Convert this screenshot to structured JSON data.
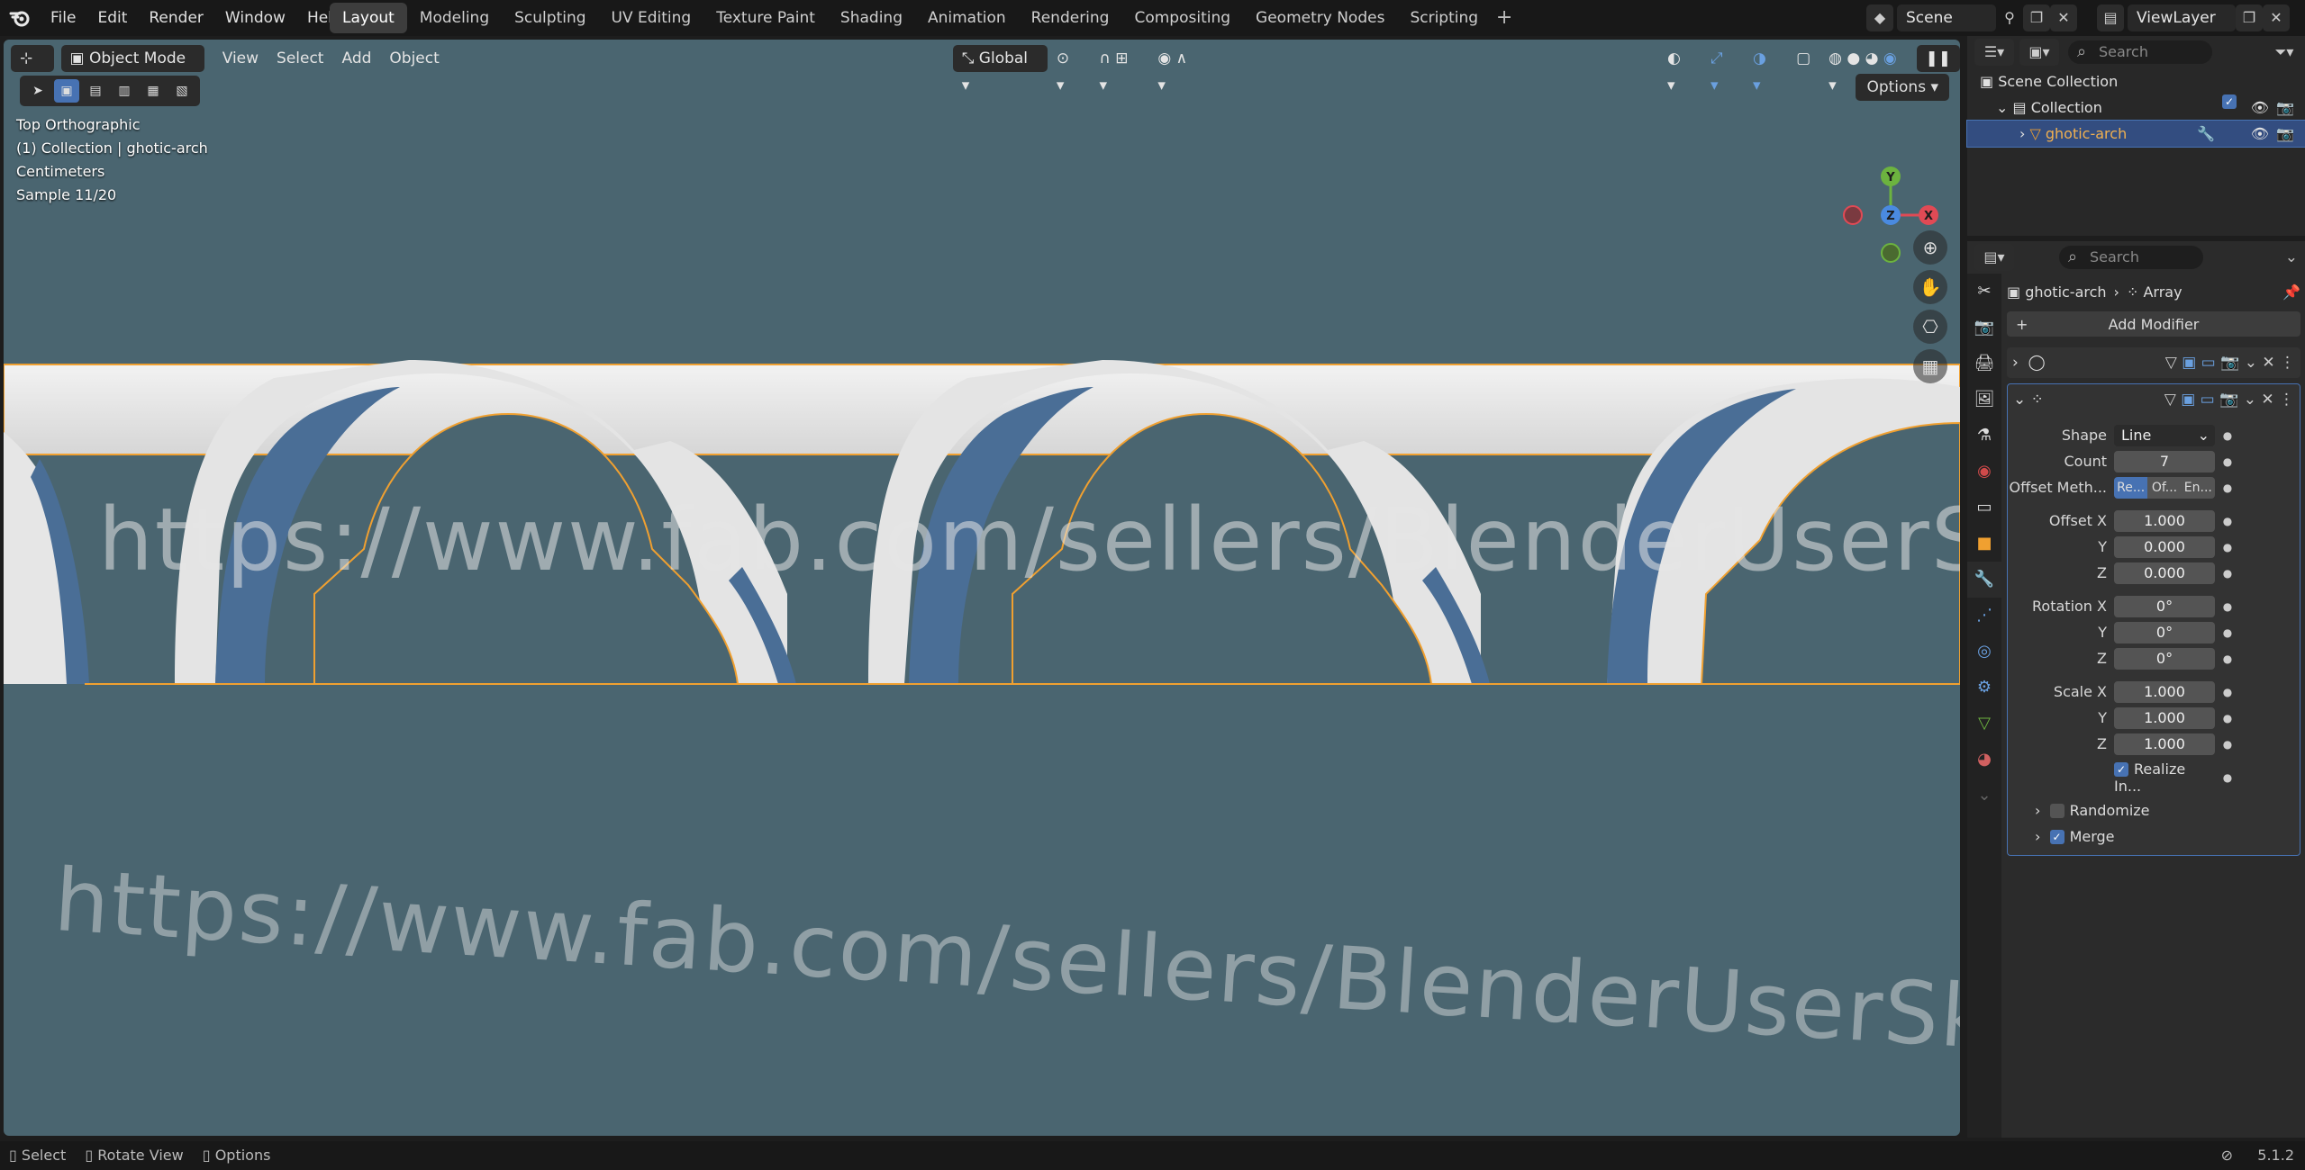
{
  "menu": [
    "File",
    "Edit",
    "Render",
    "Window",
    "Help"
  ],
  "workspace_tabs": [
    {
      "label": "Layout",
      "active": true
    },
    {
      "label": "Modeling"
    },
    {
      "label": "Sculpting"
    },
    {
      "label": "UV Editing"
    },
    {
      "label": "Texture Paint"
    },
    {
      "label": "Shading"
    },
    {
      "label": "Animation"
    },
    {
      "label": "Rendering"
    },
    {
      "label": "Compositing"
    },
    {
      "label": "Geometry Nodes"
    },
    {
      "label": "Scripting"
    }
  ],
  "tab_plus": "+",
  "scene": "Scene",
  "view_layer": "ViewLayer",
  "viewport": {
    "mode": "Object Mode",
    "menus": [
      "View",
      "Select",
      "Add",
      "Object"
    ],
    "orientation": "Global",
    "options": "Options",
    "info": {
      "line1": "Top Orthographic",
      "line2": "(1) Collection | ghotic-arch",
      "line3": "Centimeters",
      "line4": "Sample 11/20"
    },
    "gizmo": {
      "y": "Y",
      "x": "X",
      "z": "Z"
    },
    "watermark": "https://www.fab.com/sellers/BlenderUserSkfb",
    "background": "#4a6570",
    "mesh_color": "#e8e8e8",
    "accent_blue": "#4a6e96",
    "outline": "#f0a030"
  },
  "outliner": {
    "search_placeholder": "Search",
    "root": "Scene Collection",
    "collection": "Collection",
    "object": "ghotic-arch"
  },
  "properties": {
    "search_placeholder": "Search",
    "breadcrumb_object": "ghotic-arch",
    "breadcrumb_modifier": "Array",
    "add_modifier": "Add Modifier",
    "fields": {
      "shape_label": "Shape",
      "shape_value": "Line",
      "count_label": "Count",
      "count_value": "7",
      "offset_method_label": "Offset Meth...",
      "offset_method_opts": [
        "Re...",
        "Of...",
        "En..."
      ],
      "offset_x_label": "Offset X",
      "offset_x": "1.000",
      "y_label": "Y",
      "offset_y": "0.000",
      "z_label": "Z",
      "offset_z": "0.000",
      "rotation_x_label": "Rotation X",
      "rotation_x": "0°",
      "rotation_y": "0°",
      "rotation_z": "0°",
      "scale_x_label": "Scale X",
      "scale_x": "1.000",
      "scale_y": "1.000",
      "scale_z": "1.000",
      "realize_label": "Realize In...",
      "randomize_label": "Randomize",
      "merge_label": "Merge"
    }
  },
  "status": {
    "select": "Select",
    "rotate": "Rotate View",
    "options": "Options",
    "version": "5.1.2"
  },
  "accent": "#4772b3"
}
